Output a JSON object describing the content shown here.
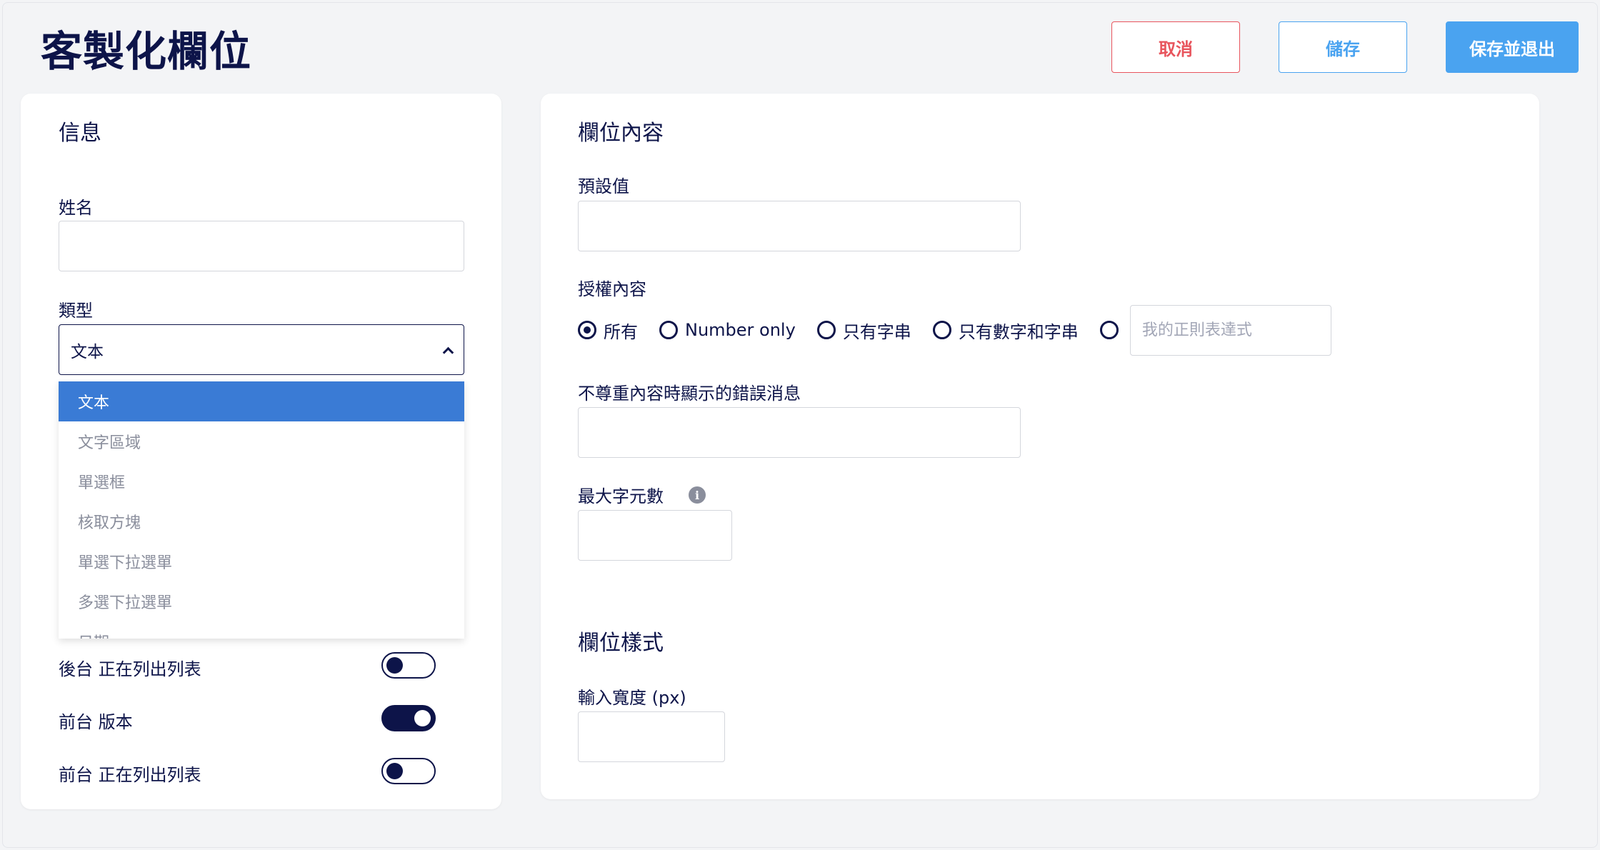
{
  "header": {
    "title": "客製化欄位",
    "cancel_label": "取消",
    "save_label": "儲存",
    "save_exit_label": "保存並退出"
  },
  "info_card": {
    "title": "信息",
    "name_label": "姓名",
    "name_value": "",
    "type_label": "類型",
    "type_selected": "文本",
    "type_options": [
      "文本",
      "文字區域",
      "單選框",
      "核取方塊",
      "單選下拉選單",
      "多選下拉選單",
      "日期"
    ],
    "toggles": [
      {
        "label": "後台 正在列出列表",
        "on": false
      },
      {
        "label": "前台 版本",
        "on": true
      },
      {
        "label": "前台 正在列出列表",
        "on": false
      }
    ]
  },
  "content_card": {
    "title": "欄位內容",
    "default_label": "預設值",
    "default_value": "",
    "allowed_label": "授權內容",
    "allowed_options": [
      "所有",
      "Number only",
      "只有字串",
      "只有數字和字串"
    ],
    "allowed_selected": "所有",
    "regex_placeholder": "我的正則表達式",
    "error_label": "不尊重內容時顯示的錯誤消息",
    "error_value": "",
    "max_chars_label": "最大字元數",
    "max_chars_value": "",
    "style_title": "欄位樣式",
    "width_label": "輸入寬度 (px)",
    "width_value": ""
  },
  "colors": {
    "navy": "#0d1449",
    "cancel_red": "#e8555d",
    "save_blue": "#4aa3f0",
    "selected_option": "#3a7bd5"
  }
}
